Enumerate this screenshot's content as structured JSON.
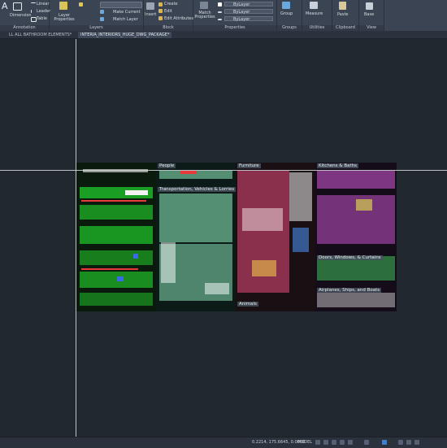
{
  "ribbon": {
    "panels": [
      {
        "title": "Annotation",
        "items": [
          "Linear",
          "Leader",
          "Table"
        ],
        "large": [
          "Text",
          "Dimension"
        ]
      },
      {
        "title": "Layers",
        "large": [
          "Layer Properties"
        ],
        "items": [
          "Make Current",
          "Match Layer"
        ]
      },
      {
        "title": "Block",
        "large": [
          "Insert"
        ],
        "items": [
          "Create",
          "Edit",
          "Edit Attributes"
        ]
      },
      {
        "title": "Properties",
        "large": [
          "Match Properties"
        ],
        "items": [
          "ByLayer",
          "ByLayer",
          "ByLayer"
        ]
      },
      {
        "title": "Groups",
        "large": [
          "Group"
        ]
      },
      {
        "title": "Utilities",
        "large": [
          "Measure"
        ]
      },
      {
        "title": "Clipboard",
        "large": [
          "Paste"
        ]
      },
      {
        "title": "View",
        "large": [
          "Base"
        ]
      }
    ]
  },
  "file_tabs": [
    {
      "label": "LL ALL BATHROOM ELEMENTS*",
      "active": false
    },
    {
      "label": "INTERIA_INTERIORS_HUGE_DWG_PACKAGE*",
      "active": true
    }
  ],
  "drawing": {
    "sections": [
      "People",
      "Transportation, Vehicles & Lorries",
      "Furniture",
      "Kitchens & Baths",
      "Doors, Windows, & Curtains",
      "Airplanes, Ships, and Boats",
      "Animals"
    ],
    "colors": {
      "trees": "#1fbf2a",
      "people": "#8ff0c0",
      "furniture": "#e84a7a",
      "kitchen": "#d35ad8",
      "background": "#0f1414"
    }
  },
  "status": {
    "coords": "0.2214, 175.6645, 0.0000",
    "mode": "MODEL"
  }
}
